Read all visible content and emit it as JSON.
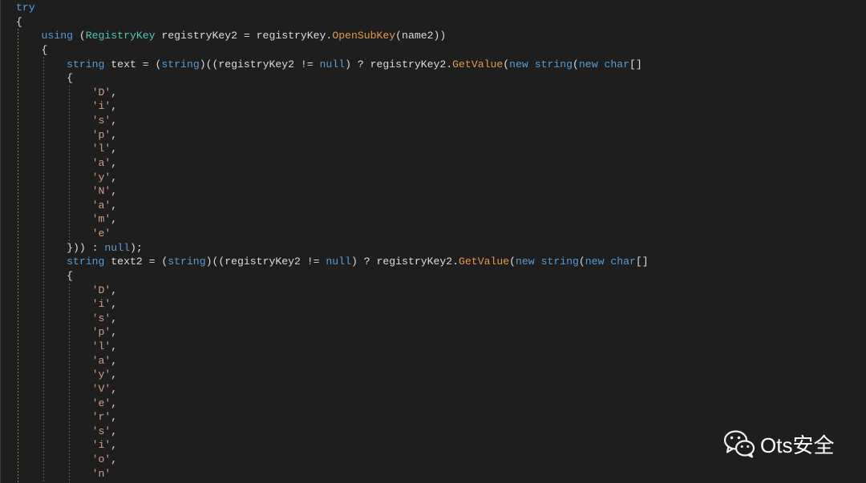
{
  "theme": {
    "background": "#1e1e1e",
    "plain": "#dcdcdc",
    "keyword": "#569cd6",
    "type": "#4ec9b0",
    "method": "#e39a4a",
    "char_literal": "#d69d85",
    "guide_try": "#a8763c",
    "guide": "#5c5c5c"
  },
  "editor": {
    "lines": [
      {
        "indent": 0,
        "tokens": [
          {
            "keyword": "try"
          }
        ]
      },
      {
        "indent": 0,
        "tokens": [
          {
            "plain": "{"
          }
        ]
      },
      {
        "indent": 1,
        "tokens": [
          {
            "keyword": "using"
          },
          {
            "plain": " ("
          },
          {
            "type": "RegistryKey"
          },
          {
            "plain": " registryKey2 = registryKey."
          },
          {
            "method": "OpenSubKey"
          },
          {
            "plain": "(name2))"
          }
        ]
      },
      {
        "indent": 1,
        "tokens": [
          {
            "plain": "{"
          }
        ]
      },
      {
        "indent": 2,
        "tokens": [
          {
            "keyword": "string"
          },
          {
            "plain": " text = ("
          },
          {
            "keyword": "string"
          },
          {
            "plain": ")((registryKey2 != "
          },
          {
            "keyword": "null"
          },
          {
            "plain": ") ? registryKey2."
          },
          {
            "method": "GetValue"
          },
          {
            "plain": "("
          },
          {
            "keyword": "new"
          },
          {
            "plain": " "
          },
          {
            "keyword": "string"
          },
          {
            "plain": "("
          },
          {
            "keyword": "new"
          },
          {
            "plain": " "
          },
          {
            "keyword": "char"
          },
          {
            "plain": "[]"
          }
        ]
      },
      {
        "indent": 2,
        "tokens": [
          {
            "plain": "{"
          }
        ]
      },
      {
        "indent": 3,
        "tokens": [
          {
            "char": "'D'"
          },
          {
            "plain": ","
          }
        ]
      },
      {
        "indent": 3,
        "tokens": [
          {
            "char": "'i'"
          },
          {
            "plain": ","
          }
        ]
      },
      {
        "indent": 3,
        "tokens": [
          {
            "char": "'s'"
          },
          {
            "plain": ","
          }
        ]
      },
      {
        "indent": 3,
        "tokens": [
          {
            "char": "'p'"
          },
          {
            "plain": ","
          }
        ]
      },
      {
        "indent": 3,
        "tokens": [
          {
            "char": "'l'"
          },
          {
            "plain": ","
          }
        ]
      },
      {
        "indent": 3,
        "tokens": [
          {
            "char": "'a'"
          },
          {
            "plain": ","
          }
        ]
      },
      {
        "indent": 3,
        "tokens": [
          {
            "char": "'y'"
          },
          {
            "plain": ","
          }
        ]
      },
      {
        "indent": 3,
        "tokens": [
          {
            "char": "'N'"
          },
          {
            "plain": ","
          }
        ]
      },
      {
        "indent": 3,
        "tokens": [
          {
            "char": "'a'"
          },
          {
            "plain": ","
          }
        ]
      },
      {
        "indent": 3,
        "tokens": [
          {
            "char": "'m'"
          },
          {
            "plain": ","
          }
        ]
      },
      {
        "indent": 3,
        "tokens": [
          {
            "char": "'e'"
          }
        ]
      },
      {
        "indent": 2,
        "tokens": [
          {
            "plain": "})) : "
          },
          {
            "keyword": "null"
          },
          {
            "plain": ");"
          }
        ]
      },
      {
        "indent": 2,
        "tokens": [
          {
            "keyword": "string"
          },
          {
            "plain": " text2 = ("
          },
          {
            "keyword": "string"
          },
          {
            "plain": ")((registryKey2 != "
          },
          {
            "keyword": "null"
          },
          {
            "plain": ") ? registryKey2."
          },
          {
            "method": "GetValue"
          },
          {
            "plain": "("
          },
          {
            "keyword": "new"
          },
          {
            "plain": " "
          },
          {
            "keyword": "string"
          },
          {
            "plain": "("
          },
          {
            "keyword": "new"
          },
          {
            "plain": " "
          },
          {
            "keyword": "char"
          },
          {
            "plain": "[]"
          }
        ]
      },
      {
        "indent": 2,
        "tokens": [
          {
            "plain": "{"
          }
        ]
      },
      {
        "indent": 3,
        "tokens": [
          {
            "char": "'D'"
          },
          {
            "plain": ","
          }
        ]
      },
      {
        "indent": 3,
        "tokens": [
          {
            "char": "'i'"
          },
          {
            "plain": ","
          }
        ]
      },
      {
        "indent": 3,
        "tokens": [
          {
            "char": "'s'"
          },
          {
            "plain": ","
          }
        ]
      },
      {
        "indent": 3,
        "tokens": [
          {
            "char": "'p'"
          },
          {
            "plain": ","
          }
        ]
      },
      {
        "indent": 3,
        "tokens": [
          {
            "char": "'l'"
          },
          {
            "plain": ","
          }
        ]
      },
      {
        "indent": 3,
        "tokens": [
          {
            "char": "'a'"
          },
          {
            "plain": ","
          }
        ]
      },
      {
        "indent": 3,
        "tokens": [
          {
            "char": "'y'"
          },
          {
            "plain": ","
          }
        ]
      },
      {
        "indent": 3,
        "tokens": [
          {
            "char": "'V'"
          },
          {
            "plain": ","
          }
        ]
      },
      {
        "indent": 3,
        "tokens": [
          {
            "char": "'e'"
          },
          {
            "plain": ","
          }
        ]
      },
      {
        "indent": 3,
        "tokens": [
          {
            "char": "'r'"
          },
          {
            "plain": ","
          }
        ]
      },
      {
        "indent": 3,
        "tokens": [
          {
            "char": "'s'"
          },
          {
            "plain": ","
          }
        ]
      },
      {
        "indent": 3,
        "tokens": [
          {
            "char": "'i'"
          },
          {
            "plain": ","
          }
        ]
      },
      {
        "indent": 3,
        "tokens": [
          {
            "char": "'o'"
          },
          {
            "plain": ","
          }
        ]
      },
      {
        "indent": 3,
        "tokens": [
          {
            "char": "'n'"
          }
        ]
      }
    ]
  },
  "watermark": {
    "icon": "wechat-icon",
    "text": "Ots安全"
  }
}
